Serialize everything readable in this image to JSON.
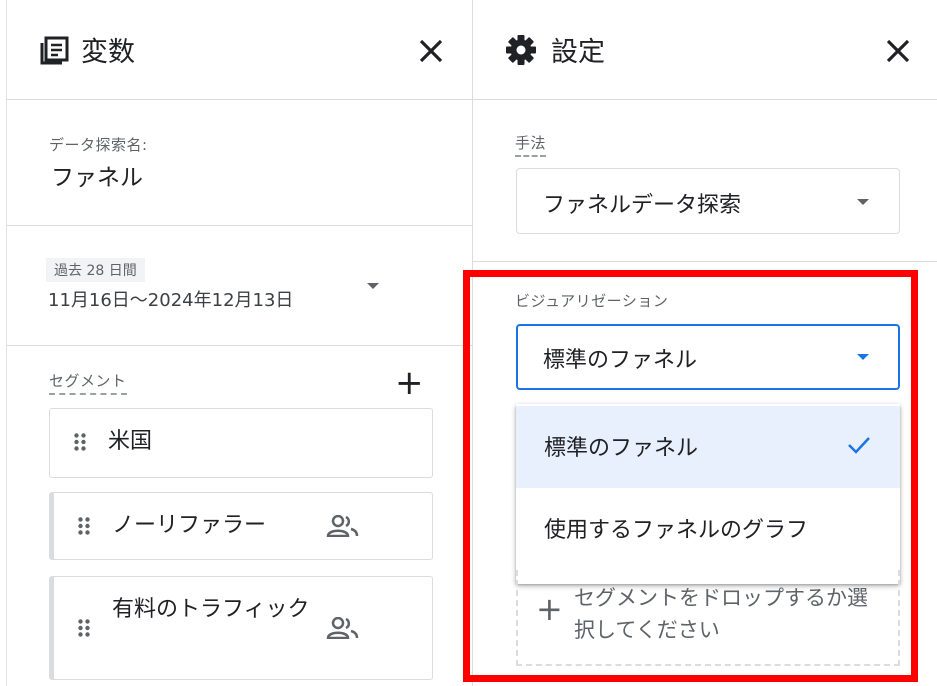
{
  "variables_panel": {
    "title": "変数",
    "icon": "variables-icon",
    "close_icon": "close-icon",
    "exploration_name_label": "データ探索名:",
    "exploration_name_value": "ファネル",
    "date_chip": "過去 28 日間",
    "date_range": "11月16日～2024年12月13日",
    "segments_label": "セグメント",
    "segments": [
      {
        "label": "米国",
        "has_people_icon": false
      },
      {
        "label": "ノーリファラー",
        "has_people_icon": true
      },
      {
        "label": "有料のトラフィック",
        "has_people_icon": true
      }
    ]
  },
  "settings_panel": {
    "title": "設定",
    "icon": "gear-icon",
    "close_icon": "close-icon",
    "technique_label": "手法",
    "technique_value": "ファネルデータ探索",
    "visualization_label": "ビジュアリゼーション",
    "visualization_value": "標準のファネル",
    "visualization_options": [
      {
        "label": "標準のファネル",
        "selected": true
      },
      {
        "label": "使用するファネルのグラフ",
        "selected": false
      }
    ],
    "segment_drop_text": "セグメントをドロップするか選択してください"
  },
  "colors": {
    "accent": "#1a73e8",
    "selected_bg": "#e8f0fe",
    "highlight_box": "#ff0000",
    "divider": "#dadce0"
  }
}
